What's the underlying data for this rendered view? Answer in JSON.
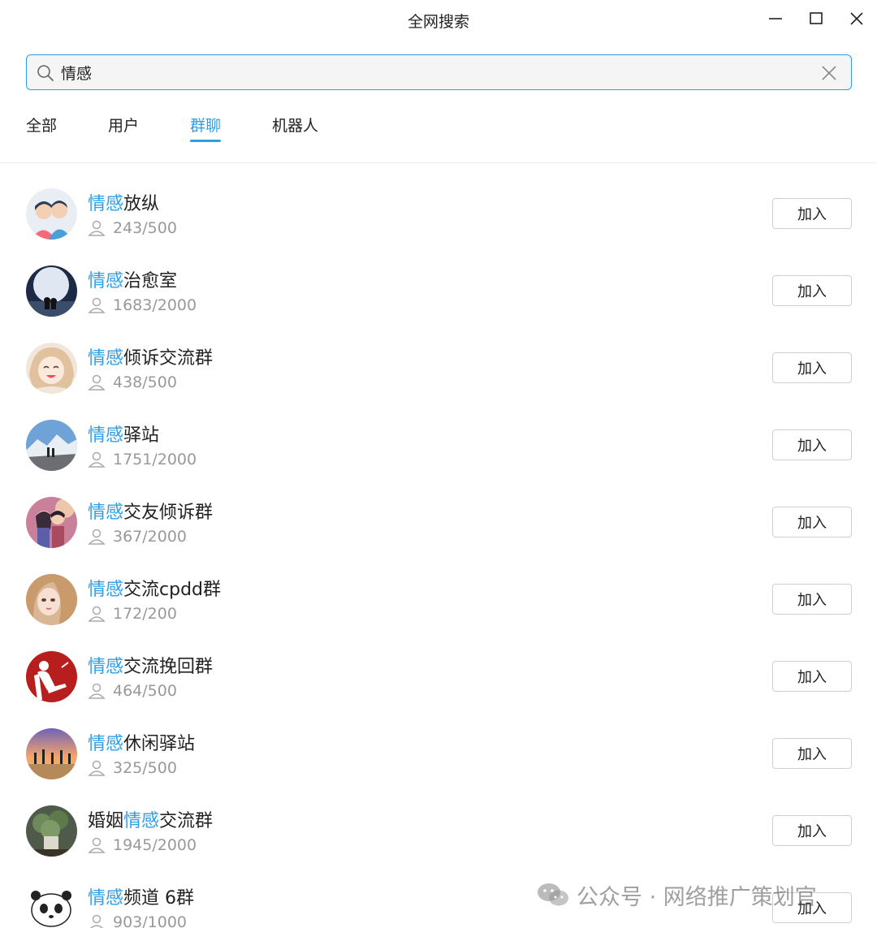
{
  "window": {
    "title": "全网搜索",
    "controls": [
      "minimize-icon",
      "maximize-icon",
      "close-icon"
    ]
  },
  "search": {
    "value": "情感",
    "icon": "search-icon",
    "clear_icon": "clear-icon"
  },
  "tabs": [
    {
      "label": "全部"
    },
    {
      "label": "用户"
    },
    {
      "label": "群聊",
      "active": true
    },
    {
      "label": "机器人"
    }
  ],
  "colors": {
    "accent": "#2f9ee8",
    "muted": "#999999"
  },
  "join_label": "加入",
  "groups": [
    {
      "name_pre": "",
      "name_hl": "情感",
      "name_post": "放纵",
      "members": "243/500"
    },
    {
      "name_pre": "",
      "name_hl": "情感",
      "name_post": "治愈室",
      "members": "1683/2000"
    },
    {
      "name_pre": "",
      "name_hl": "情感",
      "name_post": "倾诉交流群",
      "members": "438/500"
    },
    {
      "name_pre": "",
      "name_hl": "情感",
      "name_post": "驿站",
      "members": "1751/2000"
    },
    {
      "name_pre": "",
      "name_hl": "情感",
      "name_post": "交友倾诉群",
      "members": "367/2000"
    },
    {
      "name_pre": "",
      "name_hl": "情感",
      "name_post": "交流cpdd群",
      "members": "172/200"
    },
    {
      "name_pre": "",
      "name_hl": "情感",
      "name_post": "交流挽回群",
      "members": "464/500"
    },
    {
      "name_pre": "",
      "name_hl": "情感",
      "name_post": "休闲驿站",
      "members": "325/500"
    },
    {
      "name_pre": "婚姻",
      "name_hl": "情感",
      "name_post": "交流群",
      "members": "1945/2000"
    },
    {
      "name_pre": "",
      "name_hl": "情感",
      "name_post": "频道 6群",
      "members": "903/1000"
    }
  ],
  "watermark": {
    "text": "公众号 · 网络推广策划官",
    "icon": "wechat-icon"
  }
}
